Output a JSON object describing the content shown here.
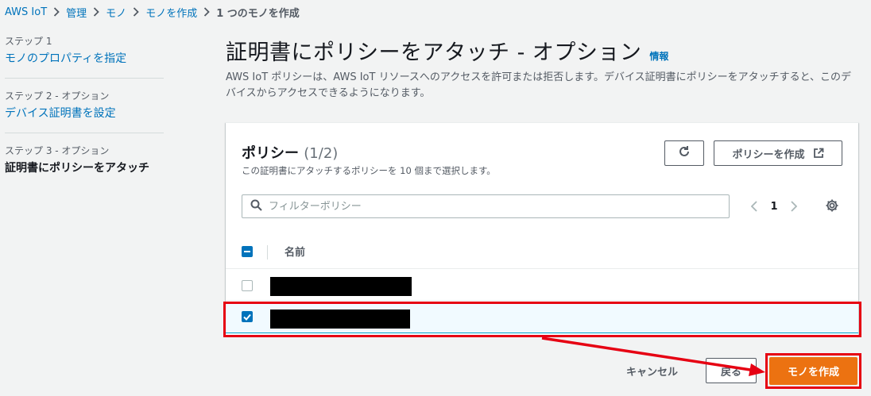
{
  "breadcrumb": {
    "items": [
      "AWS IoT",
      "管理",
      "モノ",
      "モノを作成"
    ],
    "current": "1 つのモノを作成"
  },
  "steps": [
    {
      "label": "ステップ 1",
      "title": "モノのプロパティを指定"
    },
    {
      "label": "ステップ 2 - オプション",
      "title": "デバイス証明書を設定"
    },
    {
      "label": "ステップ 3 - オプション",
      "title": "証明書にポリシーをアタッチ"
    }
  ],
  "header": {
    "title": "証明書にポリシーをアタッチ - オプション",
    "info": "情報",
    "description": "AWS IoT ポリシーは、AWS IoT リソースへのアクセスを許可または拒否します。デバイス証明書にポリシーをアタッチすると、このデバイスからアクセスできるようになります。"
  },
  "panel": {
    "title": "ポリシー",
    "count": "(1/2)",
    "subtitle": "この証明書にアタッチするポリシーを 10 個まで選択します。",
    "create_policy_label": "ポリシーを作成",
    "filter_placeholder": "フィルターポリシー",
    "page": "1",
    "column_name": "名前",
    "rows": [
      {
        "checked": false
      },
      {
        "checked": true
      }
    ]
  },
  "footer": {
    "cancel": "キャンセル",
    "back": "戻る",
    "create_thing": "モノを作成"
  },
  "colors": {
    "primary": "#ec7211",
    "link": "#0073bb",
    "annotation": "#e60012"
  },
  "icons": {
    "refresh": "refresh-icon",
    "external": "external-link-icon",
    "search": "search-icon",
    "settings": "gear-icon"
  }
}
